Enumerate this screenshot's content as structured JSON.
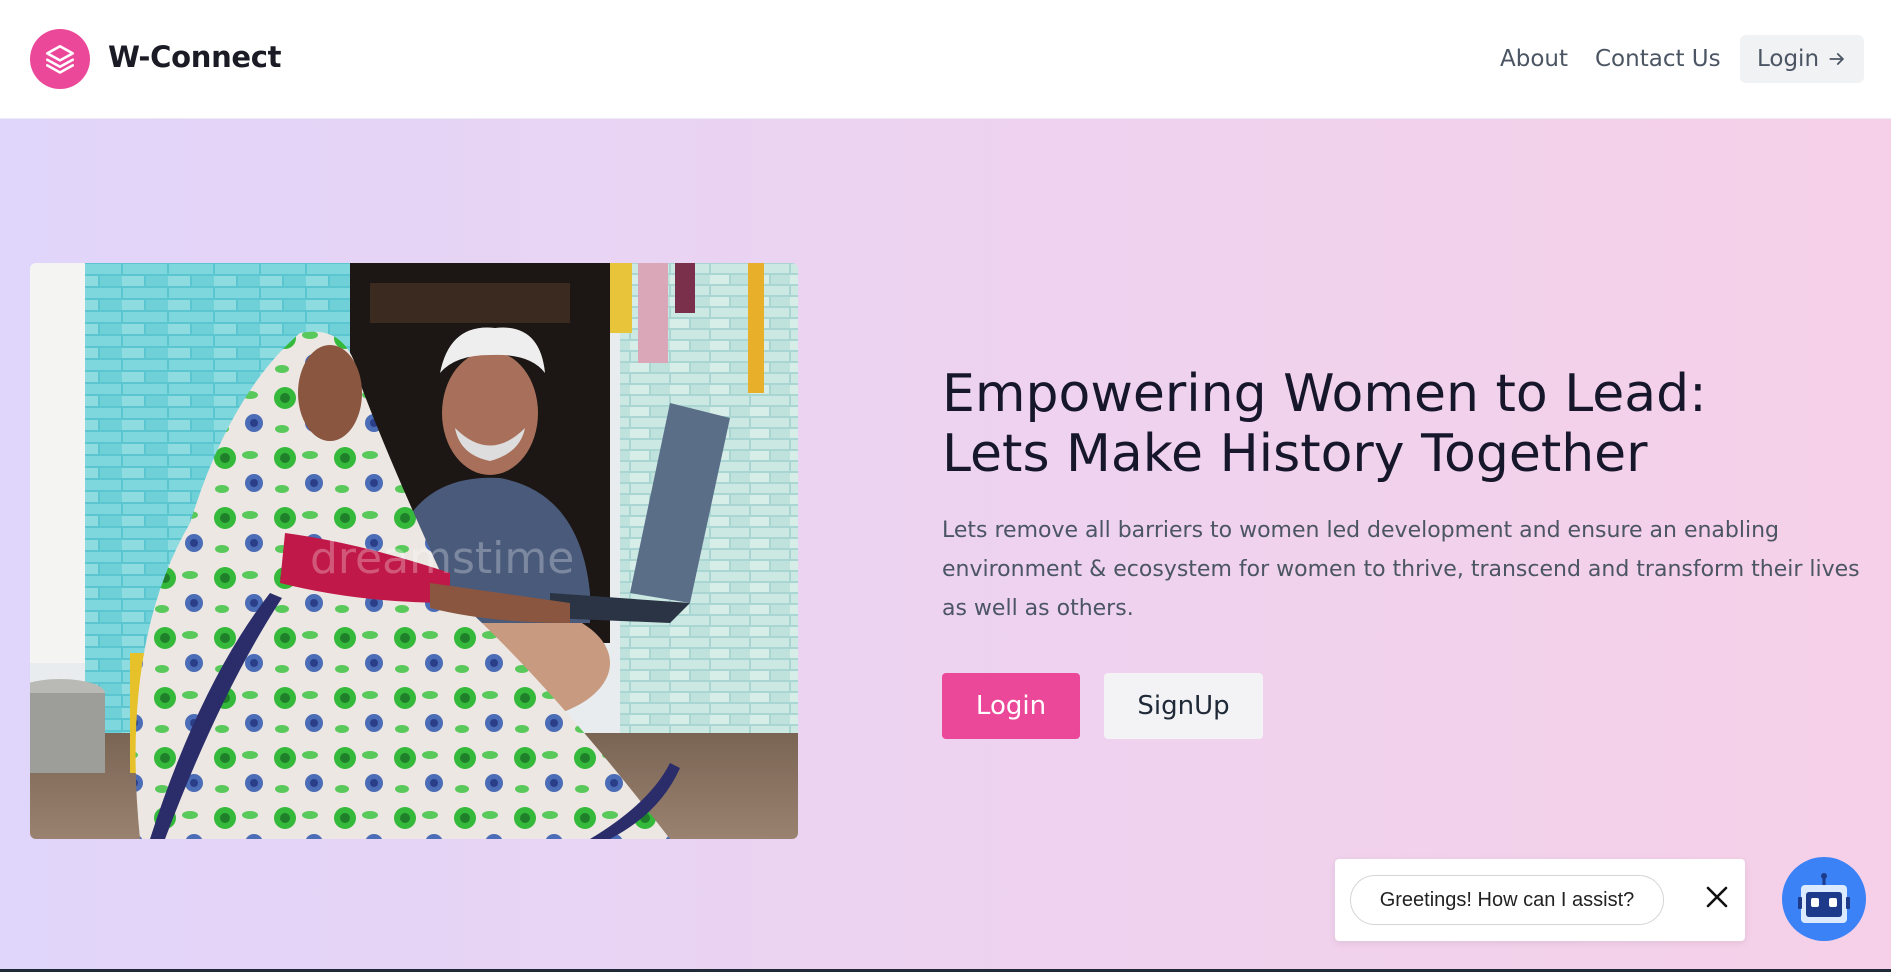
{
  "header": {
    "brand": "W-Connect",
    "logo_icon": "layers-icon",
    "nav": {
      "about": "About",
      "contact": "Contact Us",
      "login": "Login"
    }
  },
  "hero": {
    "title_line1": "Empowering Women to Lead:",
    "title_line2": "Lets Make History Together",
    "description": "Lets remove all barriers to women led development and ensure an enabling environment & ecosystem for women to thrive, transcend and transform their lives as well as others.",
    "login_button": "Login",
    "signup_button": "SignUp",
    "image_watermark": "dreamstime"
  },
  "chat": {
    "greeting": "Greetings! How can I assist?",
    "bot_icon": "robot-icon",
    "close_icon": "close-icon"
  },
  "colors": {
    "accent": "#ec4899",
    "bot": "#3b82f6"
  }
}
